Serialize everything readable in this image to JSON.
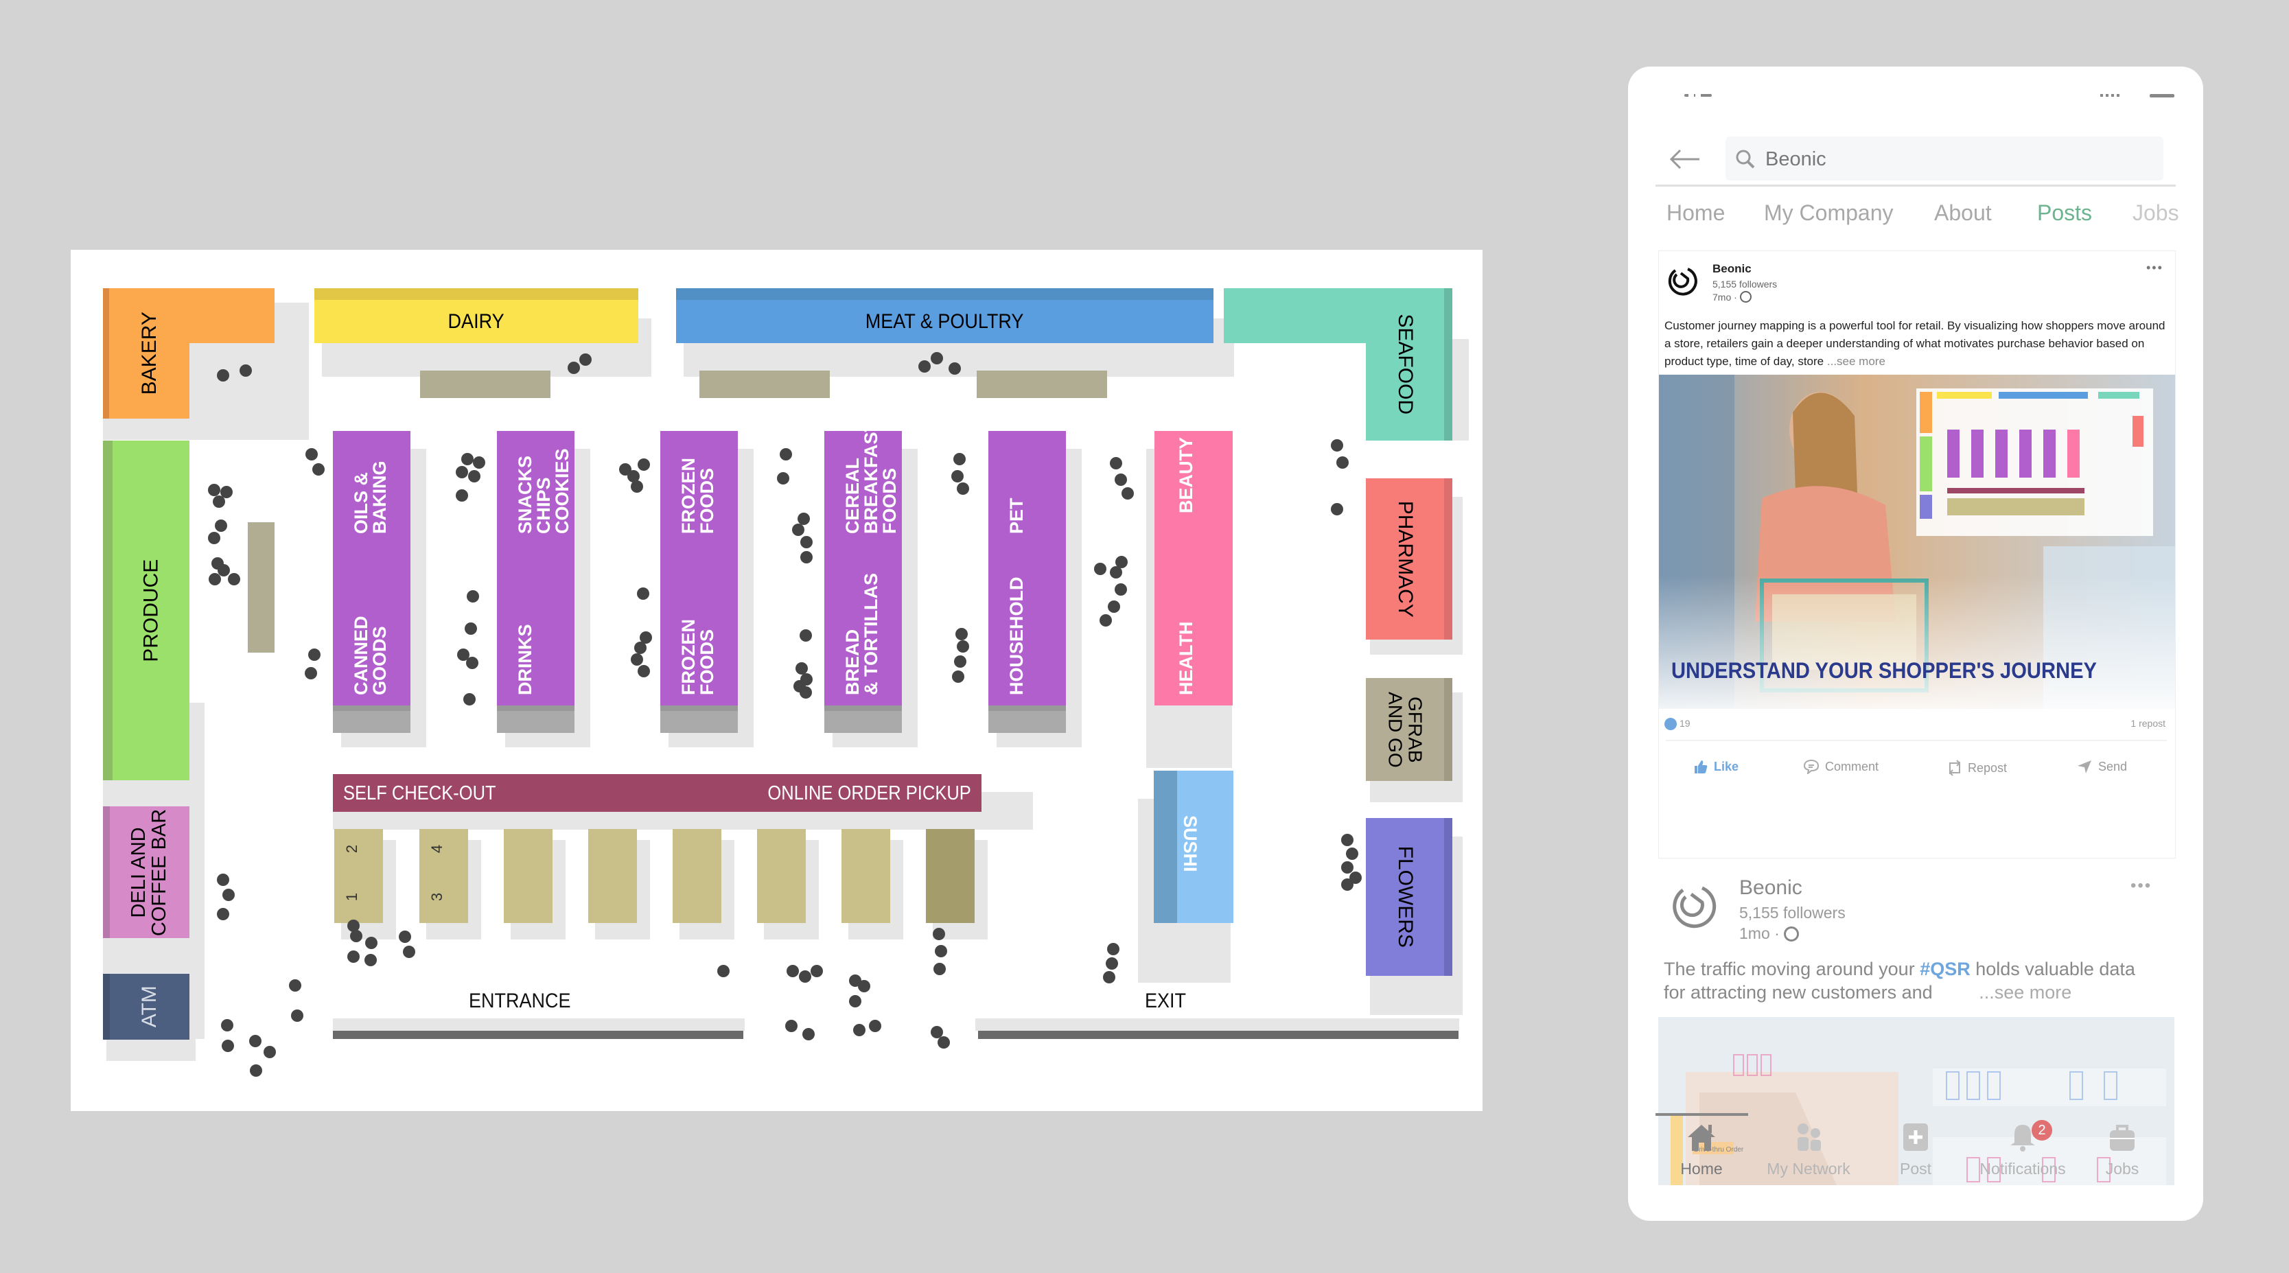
{
  "store_map": {
    "departments": {
      "bakery": "BAKERY",
      "dairy": "DAIRY",
      "meat_poultry": "MEAT & POULTRY",
      "seafood": "SEAFOOD",
      "produce": "PRODUCE",
      "pharmacy": "PHARMACY",
      "grab_and_go": "GFRAB\nAND GO",
      "deli_coffee_bar": "DELI AND\nCOFFEE BAR",
      "flowers": "FLOWERS",
      "atm": "ATM",
      "sushi": "SUSHI",
      "beauty": "BEAUTY",
      "health": "HEALTH"
    },
    "aisles": [
      {
        "top": "OILS &\nBAKING",
        "bottom": "CANNED\nGOODS"
      },
      {
        "top": "SNACKS\nCHIPS\nCOOKIES",
        "bottom": "DRINKS"
      },
      {
        "top": "FROZEN\nFOODS",
        "bottom": "FROZEN\nFOODS"
      },
      {
        "top": "CEREAL\nBREAKFAST\nFOODS",
        "bottom": "BREAD\n& TORTILLAS"
      },
      {
        "top": "PET",
        "bottom": "HOUSEHOLD"
      }
    ],
    "checkout_bar": {
      "left": "SELF CHECK-OUT",
      "right": "ONLINE ORDER PICKUP"
    },
    "lane_numbers": [
      "1",
      "2",
      "3",
      "4"
    ],
    "entrance": "ENTRANCE",
    "exit": "EXIT",
    "colors": {
      "bakery": "#fba94c",
      "dairy": "#fbe34e",
      "meat": "#5b9ee0",
      "seafood": "#78d6bd",
      "produce": "#9be06b",
      "aisle": "#b05fcc",
      "beauty": "#fd79a8",
      "pharmacy": "#f77b77",
      "grab": "#b3ad95",
      "deli": "#d68bc8",
      "flowers": "#807ed8",
      "atm": "#4c5f80",
      "sushi": "#8cc4f3",
      "checkout": "#9d4666",
      "lane": "#c8c088",
      "shopper_dot": "#444444"
    }
  },
  "phone": {
    "search": {
      "value": "Beonic"
    },
    "tabs": [
      {
        "label": "Home",
        "active": false
      },
      {
        "label": "My Company",
        "active": false
      },
      {
        "label": "About",
        "active": false
      },
      {
        "label": "Posts",
        "active": true
      },
      {
        "label": "Jobs",
        "active": false
      }
    ],
    "post1": {
      "company": "Beonic",
      "followers": "5,155 followers",
      "age": "7mo",
      "text": "Customer journey mapping is a powerful tool for retail. By visualizing how shoppers move around a store, retailers gain a deeper understanding of what motivates purchase behavior based on product type, time of day, store",
      "see_more": "...see more",
      "image_headline": "UNDERSTAND YOUR SHOPPER'S JOURNEY",
      "like_count": "19",
      "reposts": "1 repost",
      "actions": [
        "Like",
        "Comment",
        "Repost",
        "Send"
      ]
    },
    "post2": {
      "company": "Beonic",
      "followers": "5,155 followers",
      "age": "1mo",
      "text_before": "The traffic moving around your ",
      "hashtag": "#QSR",
      "text_after": " holds valuable data for attracting new customers and",
      "see_more": "...see more",
      "image_label": "Drive-thru Order"
    },
    "bottom_nav": [
      {
        "label": "Home",
        "icon": "home-icon",
        "active": true
      },
      {
        "label": "My Network",
        "icon": "network-icon",
        "active": false
      },
      {
        "label": "Post",
        "icon": "post-icon",
        "active": false
      },
      {
        "label": "Notifications",
        "icon": "bell-icon",
        "active": false,
        "badge": "2"
      },
      {
        "label": "Jobs",
        "icon": "briefcase-icon",
        "active": false
      }
    ],
    "colors": {
      "accent": "#6cb48f",
      "link": "#6fa6dd",
      "headline": "#2a3a8c",
      "badge": "#e07072"
    }
  }
}
